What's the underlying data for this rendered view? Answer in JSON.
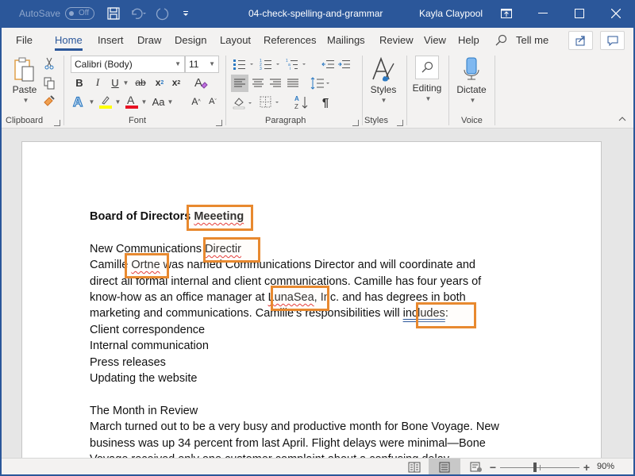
{
  "titlebar": {
    "autosave_label": "AutoSave",
    "autosave_state": "Off",
    "document_title": "04-check-spelling-and-grammar",
    "user_name": "Kayla Claypool"
  },
  "tabs": [
    {
      "label": "File"
    },
    {
      "label": "Home",
      "active": true
    },
    {
      "label": "Insert"
    },
    {
      "label": "Draw"
    },
    {
      "label": "Design"
    },
    {
      "label": "Layout"
    },
    {
      "label": "References"
    },
    {
      "label": "Mailings"
    },
    {
      "label": "Review"
    },
    {
      "label": "View"
    },
    {
      "label": "Help"
    }
  ],
  "tell_me": "Tell me",
  "ribbon": {
    "clipboard": {
      "paste_label": "Paste",
      "group_label": "Clipboard"
    },
    "font": {
      "font_name": "Calibri (Body)",
      "font_size": "11",
      "group_label": "Font",
      "bold": "B",
      "italic": "I",
      "underline": "U",
      "strike": "ab",
      "subscript": "x",
      "superscript": "x",
      "change_case": "Aa",
      "highlight_color": "#ffff00",
      "font_color": "#e81123"
    },
    "paragraph": {
      "group_label": "Paragraph",
      "pilcrow": "¶"
    },
    "styles": {
      "label": "Styles",
      "group_label": "Styles"
    },
    "editing": {
      "label": "Editing"
    },
    "voice": {
      "dictate_label": "Dictate",
      "group_label": "Voice"
    }
  },
  "document": {
    "heading": {
      "before": "Board of Directors ",
      "error": "Meeeting"
    },
    "line1": {
      "before": "New Communications ",
      "error": "Directir"
    },
    "line2": {
      "before": "Camille ",
      "error": "Ortne",
      "after": " was named Communications Director and will coordinate and"
    },
    "line3": "direct all formal internal and client communications. Camille has four years of",
    "line4": {
      "before": "know-how as an office manager at ",
      "error": "LunaSea",
      "after": ", Inc. and has degrees in both"
    },
    "line5": {
      "before": "marketing and communications. Camille’s responsibilities will ",
      "grammar": "includes",
      "after": ":"
    },
    "list": [
      "Client correspondence",
      "Internal communication",
      "Press releases",
      "Updating the website"
    ],
    "section_title": "The Month in Review",
    "body1": "March turned out to be a very busy and productive month for Bone Voyage. New",
    "body2": "business was up 34 percent from last April. Flight delays were minimal—Bone",
    "body3": "Voyage received only one customer complaint about a confusing delay"
  },
  "statusbar": {
    "zoom_level": "90%",
    "zoom_minus": "−",
    "zoom_plus": "+",
    "zoom_percent_value": 90
  },
  "colors": {
    "accent": "#2b579a",
    "highlight_box": "#e8892f",
    "spelling_underline": "#e02020",
    "grammar_underline": "#2b579a"
  }
}
